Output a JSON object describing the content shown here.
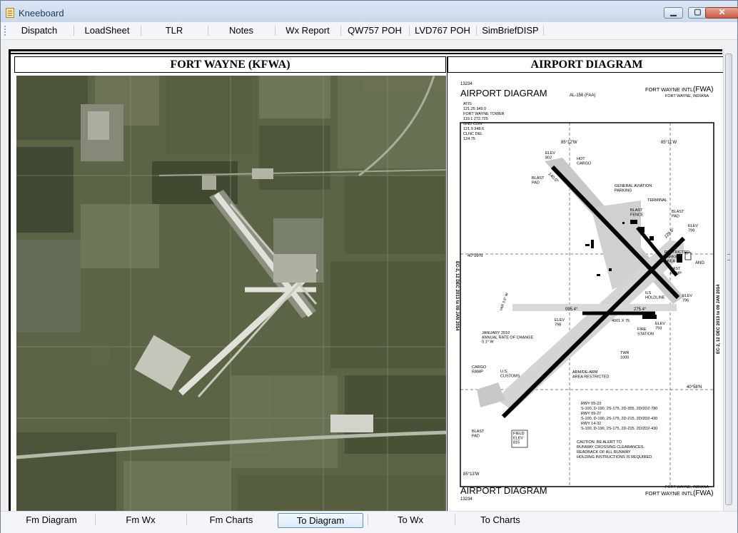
{
  "window": {
    "title": "Kneeboard",
    "minimize_symbol": "▁",
    "maximize_symbol": "▢",
    "close_symbol": "✕"
  },
  "toolbar": {
    "items": [
      "Dispatch",
      "LoadSheet",
      "TLR",
      "Notes",
      "Wx Report",
      "QW757 POH",
      "LVD767 POH",
      "SimBriefDISP"
    ]
  },
  "panels": {
    "left_title": "FORT WAYNE (KFWA)",
    "right_title": "AIRPORT DIAGRAM"
  },
  "diagram": {
    "doc_number": "13234",
    "title": "AIRPORT DIAGRAM",
    "al_code": "AL-156 (FAA)",
    "airport_name": "FORT WAYNE INTL",
    "airport_code": "(FWA)",
    "city": "FORT WAYNE, INDIANA",
    "freqs": [
      "ATIS",
      "121.25  349.0",
      "FORT WAYNE TOWER",
      "119.1  272.725",
      "GND CON",
      "121.9  348.6",
      "CLNC DEL",
      "124.75"
    ],
    "lon_top_left": "85°12'W",
    "lon_top_right": "85°11'W",
    "lon_bottom": "85°13'W",
    "lat_mid": "40°59'N",
    "lat_bottom": "40°58'N",
    "side_text": "EC-2, 12 DEC 2013 to 09 JAN 2014",
    "elev_802": "ELEV\n802",
    "hot_cargo": "HOT\nCARGO",
    "blast_pad": "BLAST\nPAD",
    "general_aviation": "GENERAL AVIATION\nPARKING",
    "terminal": "TERMINAL",
    "blast_fence": "BLAST\nFENCE",
    "elev_799": "ELEV\n799",
    "restricted": "RESTRICTED\nPARKING\nAREA",
    "east_ramp": "EAST\nRAMP",
    "ang": "ANG",
    "ils_holdline": "ILS\nHOLDLINE",
    "elev_796": "ELEV\n796",
    "elev_798": "ELEV\n798",
    "elev_793": "ELEV\n793",
    "fire_station": "FIRE\nSTATION",
    "twr": "TWR\n1000",
    "var_note": "JANUARY 2010\nANNUAL RATE OF CHANGE\n0.1° W",
    "var": "VAR 3.9° W",
    "rwy_dims_1": "4001 X 75",
    "rwy_heading_275": "275.4°",
    "rwy_heading_095": "095.4°",
    "rwy_heading_140": "140.0°",
    "rwy_heading_229": "229.6°",
    "cargo_ramp": "CARGO\nRAMP",
    "us_customs": "U.S.\nCUSTOMS",
    "arm_area": "ARM/DE-ARM\nAREA RESTRICTED",
    "field_elev": "FIELD\nELEV\n815",
    "rwy_notes": [
      "RWY 05-23",
      "S-100, D-190, 2S-175, 2D-355, 2D/2D2-780",
      "RWY 09-27",
      "S-100, D-190, 2S-175, 2D-215, 2D/2D2-430",
      "RWY 14-32",
      "S-100, D-190, 2S-175, 2D-215, 2D/2D2-430"
    ],
    "caution": [
      "CAUTION:  BE ALERT TO",
      "RUNWAY CROSSING CLEARANCES.",
      "READBACK OF ALL RUNWAY",
      "HOLDING INSTRUCTIONS IS REQUIRED."
    ],
    "footer_city": "FORT WAYNE, INDIANA",
    "footer_name": "FORT WAYNE INTL",
    "footer_code": "(FWA)",
    "footer_title": "AIRPORT DIAGRAM",
    "footer_doc": "13234"
  },
  "bottom": {
    "items": [
      "Fm Diagram",
      "Fm Wx",
      "Fm Charts",
      "To Diagram",
      "To Wx",
      "To Charts"
    ]
  },
  "colors": {
    "photo_base": "#5a6343",
    "active_button_border": "#5b8fc9"
  }
}
